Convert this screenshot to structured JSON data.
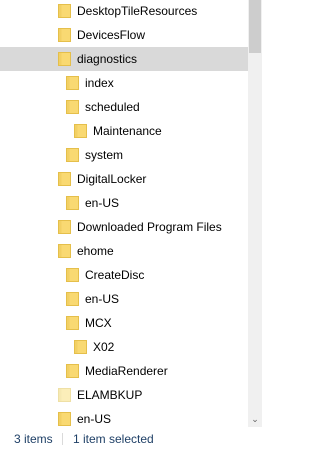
{
  "tree": {
    "items": [
      {
        "label": "DesktopTileResources",
        "level": 0,
        "icon": "folder-icon",
        "selected": false,
        "faded": false
      },
      {
        "label": "DevicesFlow",
        "level": 0,
        "icon": "folder-icon",
        "selected": false,
        "faded": false
      },
      {
        "label": "diagnostics",
        "level": 0,
        "icon": "folder-open-icon",
        "selected": true,
        "faded": false
      },
      {
        "label": "index",
        "level": 1,
        "icon": "folder-icon",
        "selected": false,
        "faded": false
      },
      {
        "label": "scheduled",
        "level": 1,
        "icon": "folder-icon",
        "selected": false,
        "faded": false
      },
      {
        "label": "Maintenance",
        "level": 2,
        "icon": "folder-icon",
        "selected": false,
        "faded": false
      },
      {
        "label": "system",
        "level": 1,
        "icon": "folder-icon",
        "selected": false,
        "faded": false
      },
      {
        "label": "DigitalLocker",
        "level": 0,
        "icon": "folder-icon",
        "selected": false,
        "faded": false
      },
      {
        "label": "en-US",
        "level": 1,
        "icon": "folder-icon",
        "selected": false,
        "faded": false
      },
      {
        "label": "Downloaded Program Files",
        "level": 0,
        "icon": "folder-icon",
        "selected": false,
        "faded": false
      },
      {
        "label": "ehome",
        "level": 0,
        "icon": "folder-icon",
        "selected": false,
        "faded": false
      },
      {
        "label": "CreateDisc",
        "level": 1,
        "icon": "folder-icon",
        "selected": false,
        "faded": false
      },
      {
        "label": "en-US",
        "level": 1,
        "icon": "folder-icon",
        "selected": false,
        "faded": false
      },
      {
        "label": "MCX",
        "level": 1,
        "icon": "folder-icon",
        "selected": false,
        "faded": false
      },
      {
        "label": "X02",
        "level": 2,
        "icon": "folder-icon",
        "selected": false,
        "faded": false
      },
      {
        "label": "MediaRenderer",
        "level": 1,
        "icon": "folder-icon",
        "selected": false,
        "faded": false
      },
      {
        "label": "ELAMBKUP",
        "level": 0,
        "icon": "folder-icon",
        "selected": false,
        "faded": true
      },
      {
        "label": "en-US",
        "level": 0,
        "icon": "folder-icon",
        "selected": false,
        "faded": false
      }
    ]
  },
  "scrollbar": {
    "down_arrow": "⌄"
  },
  "status": {
    "items_count": "3 items",
    "selection": "1 item selected"
  },
  "colors": {
    "folder": "#f9d972",
    "folder_faded": "#fbeeb9",
    "selected_row": "#d9d9d9",
    "status_text": "#1e3f66"
  }
}
